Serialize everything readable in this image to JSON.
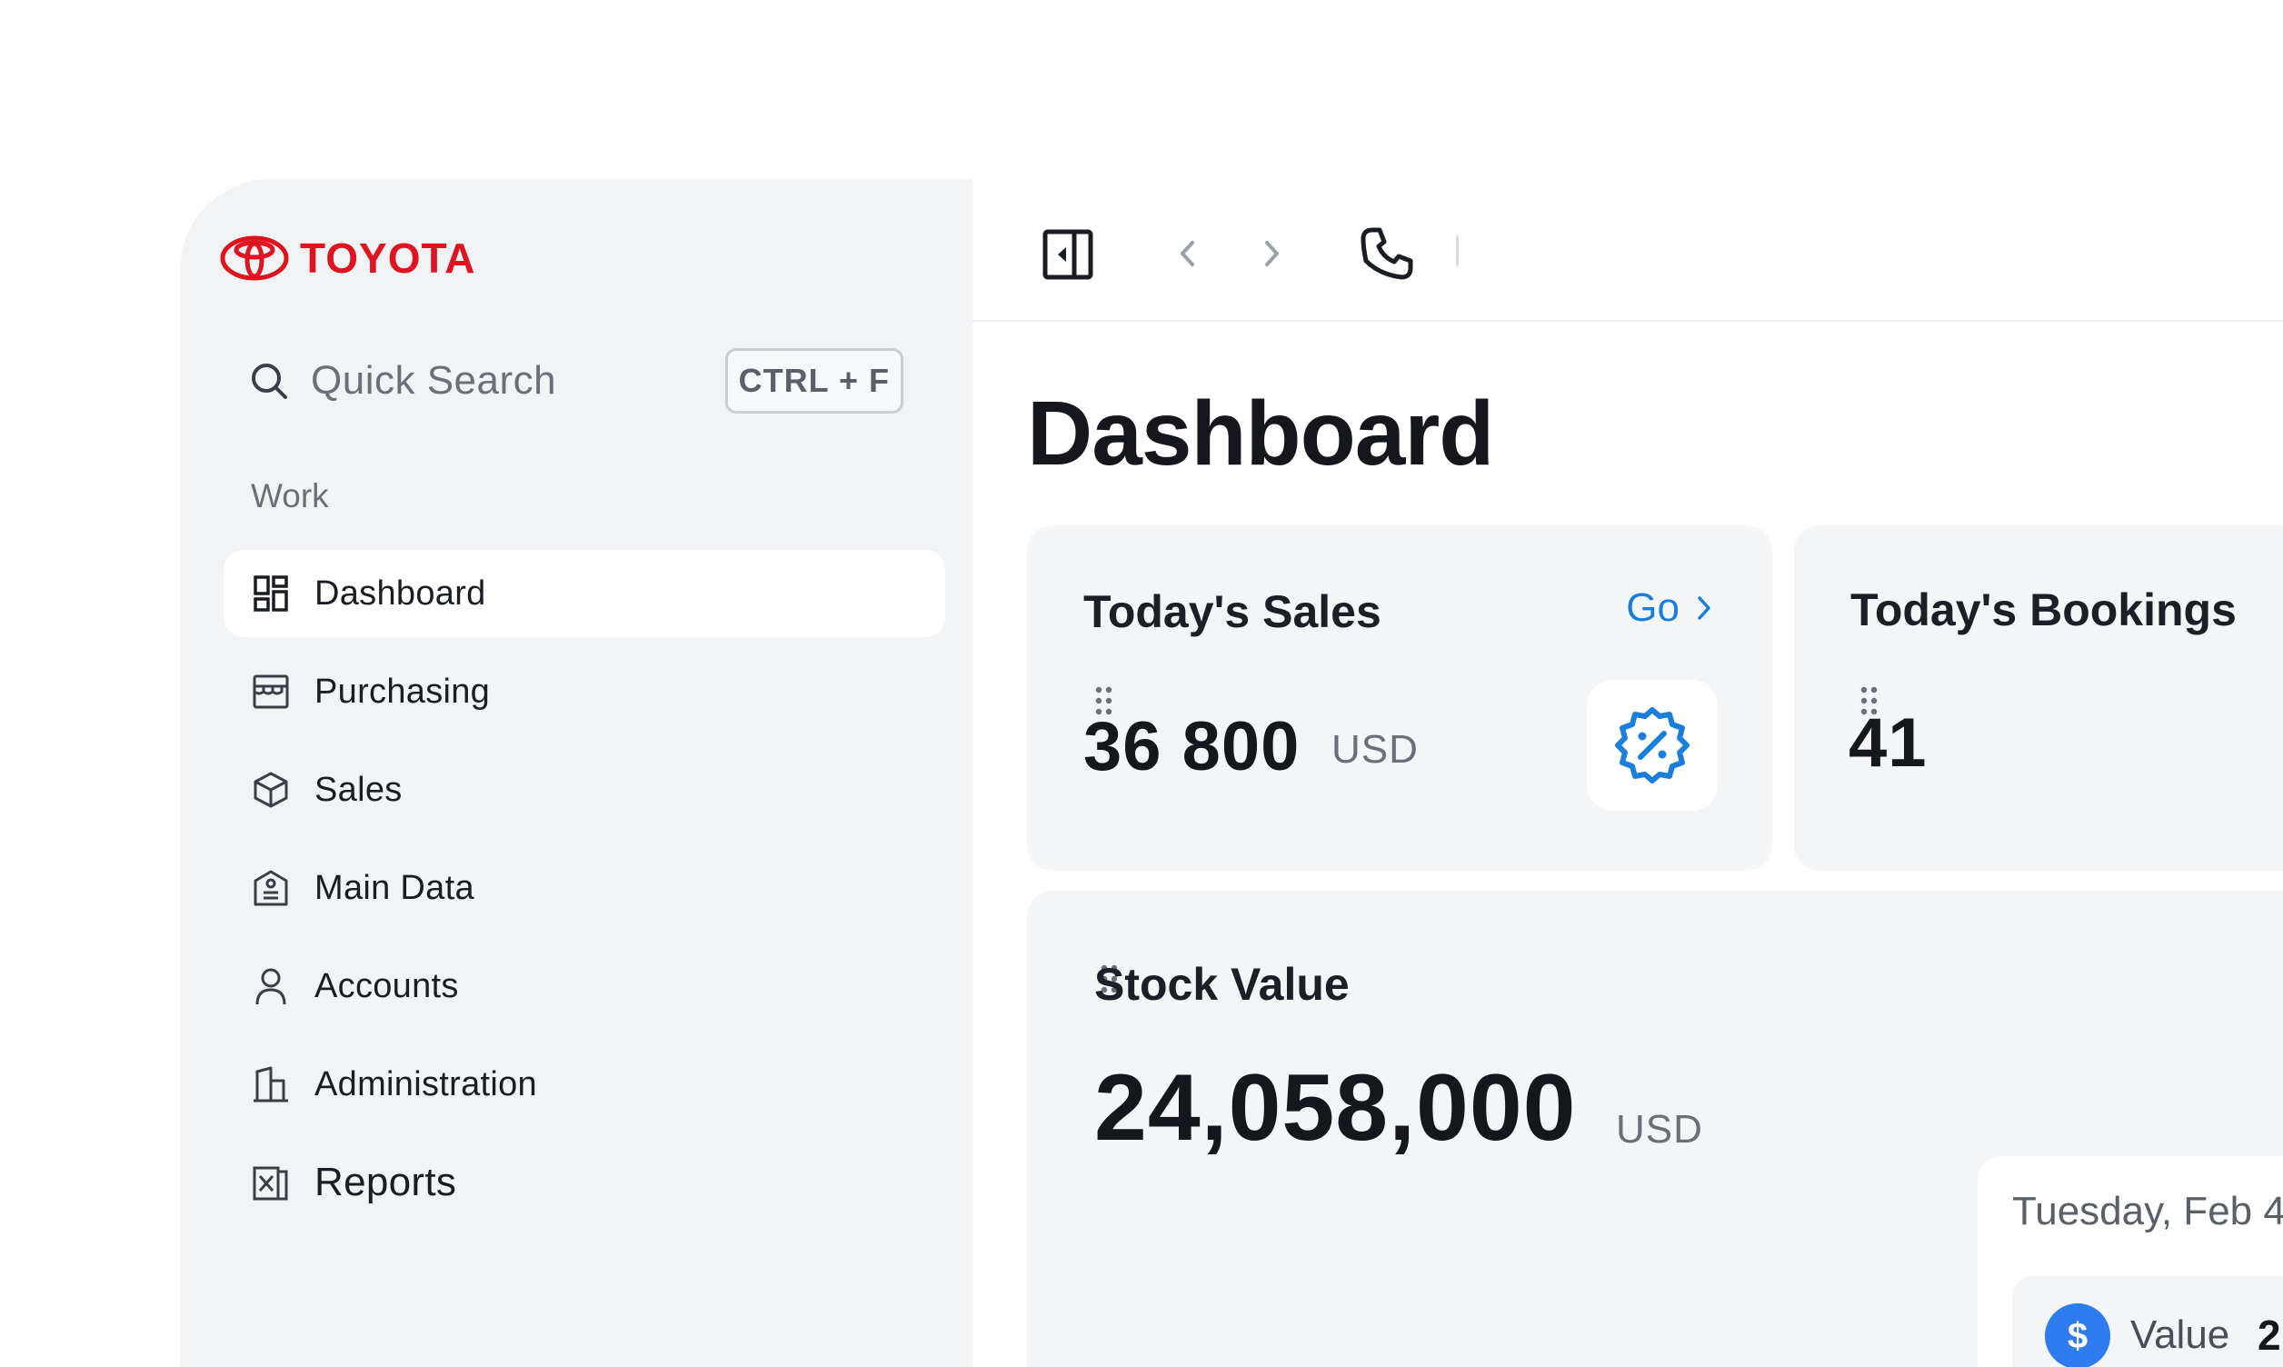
{
  "brand": {
    "name": "TOYOTA",
    "color": "#e0141e"
  },
  "search": {
    "placeholder": "Quick Search",
    "shortcut": "CTRL + F"
  },
  "sidebar": {
    "section_label": "Work",
    "items": [
      {
        "label": "Dashboard",
        "icon": "dashboard-grid-icon",
        "active": true
      },
      {
        "label": "Purchasing",
        "icon": "storefront-icon"
      },
      {
        "label": "Sales",
        "icon": "box-icon"
      },
      {
        "label": "Main Data",
        "icon": "id-badge-icon"
      },
      {
        "label": "Accounts",
        "icon": "user-icon"
      },
      {
        "label": "Administration",
        "icon": "building-icon"
      },
      {
        "label": "Reports",
        "icon": "excel-file-icon"
      }
    ]
  },
  "topbar": {
    "icons": [
      "sidebar-toggle-icon",
      "chevron-left-icon",
      "chevron-right-icon",
      "phone-icon"
    ]
  },
  "main": {
    "title": "Dashboard",
    "cards": {
      "sales": {
        "title": "Today's Sales",
        "link": "Go",
        "value": "36 800",
        "unit": "USD",
        "icon": "discount-badge-icon"
      },
      "bookings": {
        "title": "Today's Bookings",
        "value": "41"
      },
      "stock": {
        "title": "Stock Value",
        "value": "24,058,000",
        "unit": "USD"
      }
    },
    "mini": {
      "date": "Tuesday, Feb 4",
      "label": "Value",
      "value": "2",
      "icon": "dollar-icon"
    }
  },
  "colors": {
    "accent": "#1a7fdc",
    "sidebar_bg": "#f2f3f5",
    "card_bg": "#f4f5f7",
    "dollar_badge": "#2f7cf0"
  }
}
